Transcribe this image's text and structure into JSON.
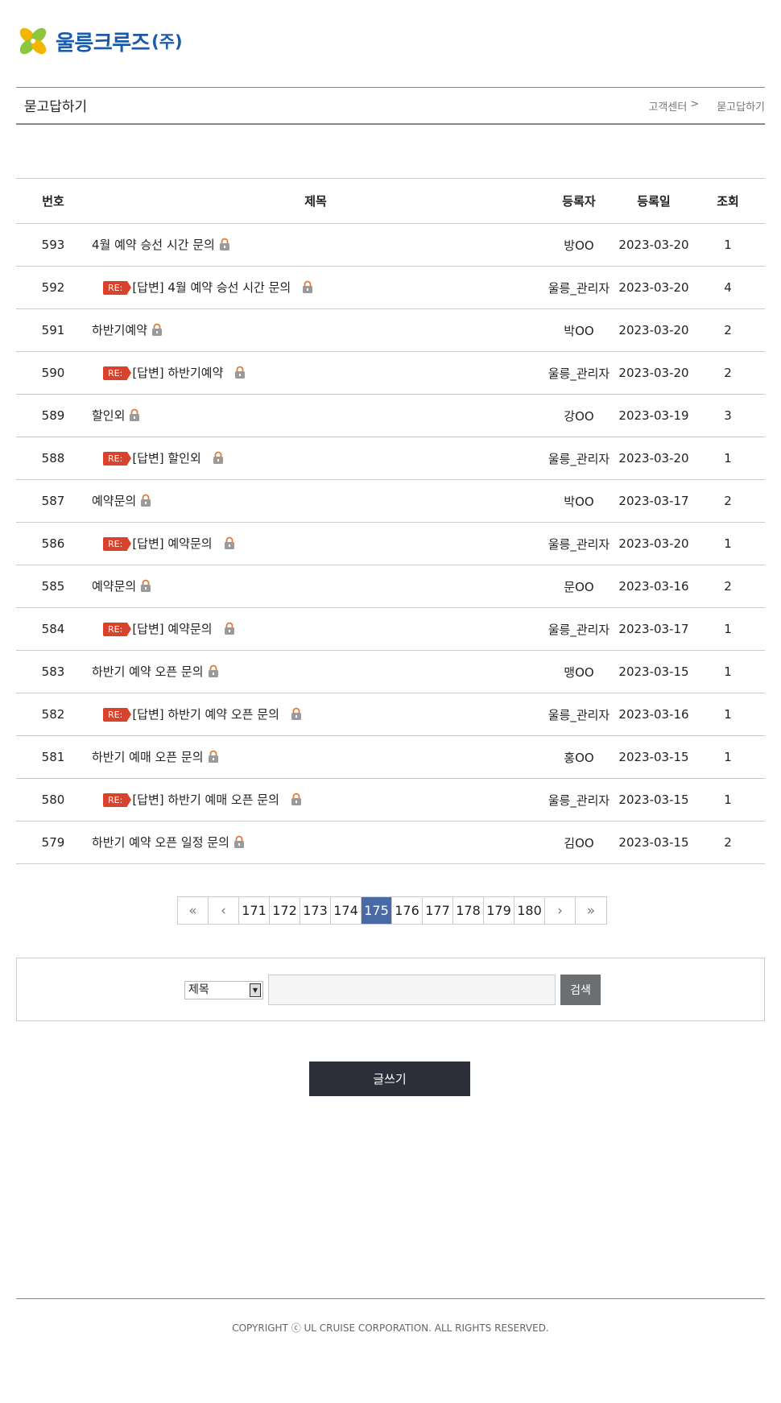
{
  "logo": {
    "text": "울릉크루즈",
    "suffix": "(주)"
  },
  "header": {
    "title": "묻고답하기",
    "breadcrumb": [
      "고객센터",
      ">",
      "묻고답하기"
    ]
  },
  "table": {
    "columns": [
      "번호",
      "제목",
      "등록자",
      "등록일",
      "조회"
    ],
    "rows": [
      {
        "no": "593",
        "subject": "4월 예약 승선 시간 문의",
        "reply": false,
        "author": "방OO",
        "date": "2023-03-20",
        "views": "1"
      },
      {
        "no": "592",
        "subject": "[답변] 4월 예약 승선 시간 문의",
        "reply": true,
        "author": "울릉_관리자",
        "date": "2023-03-20",
        "views": "4"
      },
      {
        "no": "591",
        "subject": "하반기예약",
        "reply": false,
        "author": "박OO",
        "date": "2023-03-20",
        "views": "2"
      },
      {
        "no": "590",
        "subject": "[답변] 하반기예약",
        "reply": true,
        "author": "울릉_관리자",
        "date": "2023-03-20",
        "views": "2"
      },
      {
        "no": "589",
        "subject": "할인외",
        "reply": false,
        "author": "강OO",
        "date": "2023-03-19",
        "views": "3"
      },
      {
        "no": "588",
        "subject": "[답변] 할인외",
        "reply": true,
        "author": "울릉_관리자",
        "date": "2023-03-20",
        "views": "1"
      },
      {
        "no": "587",
        "subject": "예약문의",
        "reply": false,
        "author": "박OO",
        "date": "2023-03-17",
        "views": "2"
      },
      {
        "no": "586",
        "subject": "[답변] 예약문의",
        "reply": true,
        "author": "울릉_관리자",
        "date": "2023-03-20",
        "views": "1"
      },
      {
        "no": "585",
        "subject": "예약문의",
        "reply": false,
        "author": "문OO",
        "date": "2023-03-16",
        "views": "2"
      },
      {
        "no": "584",
        "subject": "[답변] 예약문의",
        "reply": true,
        "author": "울릉_관리자",
        "date": "2023-03-17",
        "views": "1"
      },
      {
        "no": "583",
        "subject": "하반기 예약 오픈 문의",
        "reply": false,
        "author": "맹OO",
        "date": "2023-03-15",
        "views": "1"
      },
      {
        "no": "582",
        "subject": "[답변] 하반기 예약 오픈 문의",
        "reply": true,
        "author": "울릉_관리자",
        "date": "2023-03-16",
        "views": "1"
      },
      {
        "no": "581",
        "subject": "하반기 예매 오픈 문의",
        "reply": false,
        "author": "홍OO",
        "date": "2023-03-15",
        "views": "1"
      },
      {
        "no": "580",
        "subject": "[답변] 하반기 예매 오픈 문의",
        "reply": true,
        "author": "울릉_관리자",
        "date": "2023-03-15",
        "views": "1"
      },
      {
        "no": "579",
        "subject": "하반기 예약 오픈 일정 문의",
        "reply": false,
        "author": "김OO",
        "date": "2023-03-15",
        "views": "2"
      }
    ],
    "re_badge": "RE:"
  },
  "pagination": {
    "first": "«",
    "prev": "‹",
    "pages": [
      "171",
      "172",
      "173",
      "174",
      "175",
      "176",
      "177",
      "178",
      "179",
      "180"
    ],
    "current": "175",
    "next": "›",
    "last": "»"
  },
  "search": {
    "select_value": "제목",
    "input_value": "",
    "button_label": "검색"
  },
  "write_button": "글쓰기",
  "footer": {
    "copyright": "COPYRIGHT ⓒ UL CRUISE CORPORATION. ALL RIGHTS RESERVED."
  },
  "colors": {
    "brand_blue": "#1a5aa8",
    "re_badge": "#d9432b",
    "active_page": "#4a6aa6",
    "write_button": "#2c2f3a",
    "search_button": "#6c6f72"
  },
  "icons": {
    "logo": "clover-logo-icon",
    "lock": "lock-icon",
    "select_arrow": "dropdown-arrow-icon"
  }
}
